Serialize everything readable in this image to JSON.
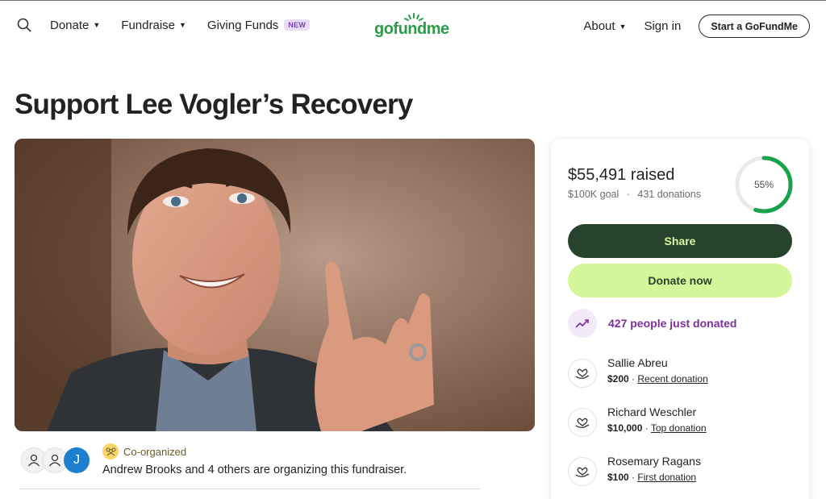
{
  "header": {
    "nav_left": [
      {
        "label": "Donate",
        "has_caret": true
      },
      {
        "label": "Fundraise",
        "has_caret": true
      },
      {
        "label": "Giving Funds",
        "badge": "NEW"
      }
    ],
    "logo_text": "gofundme",
    "nav_right": [
      {
        "label": "About",
        "has_caret": true
      },
      {
        "label": "Sign in"
      }
    ],
    "start_button": "Start a GoFundMe",
    "icons": {
      "search": "search-icon",
      "caret": "chevron-down-icon",
      "logo": "gofundme-sun-icon"
    }
  },
  "campaign": {
    "title": "Support Lee Vogler’s Recovery",
    "photo_alt": "campaign-photo"
  },
  "organizers": {
    "avatar_letter": "J",
    "co_label": "Co-organized",
    "text": "Andrew Brooks and 4 others are organizing this fundraiser."
  },
  "donation_card": {
    "raised": "$55,491 raised",
    "goal": "$100K goal",
    "separator": "·",
    "donations": "431 donations",
    "progress_percent": 55,
    "progress_label": "55%",
    "share_label": "Share",
    "donate_label": "Donate now",
    "trend_text": "427 people just donated",
    "donors": [
      {
        "name": "Sallie Abreu",
        "amount": "$200",
        "sep": " · ",
        "tag": "Recent donation"
      },
      {
        "name": "Richard Weschler",
        "amount": "$10,000",
        "sep": " · ",
        "tag": "Top donation"
      },
      {
        "name": "Rosemary Ragans",
        "amount": "$100",
        "sep": " · ",
        "tag": "First donation"
      }
    ]
  },
  "colors": {
    "brand_green": "#2c9b4a",
    "share_bg": "#27432c",
    "donate_bg": "#d3f79a",
    "trend_purple": "#7b2f9a",
    "progress_green": "#16a34a"
  }
}
